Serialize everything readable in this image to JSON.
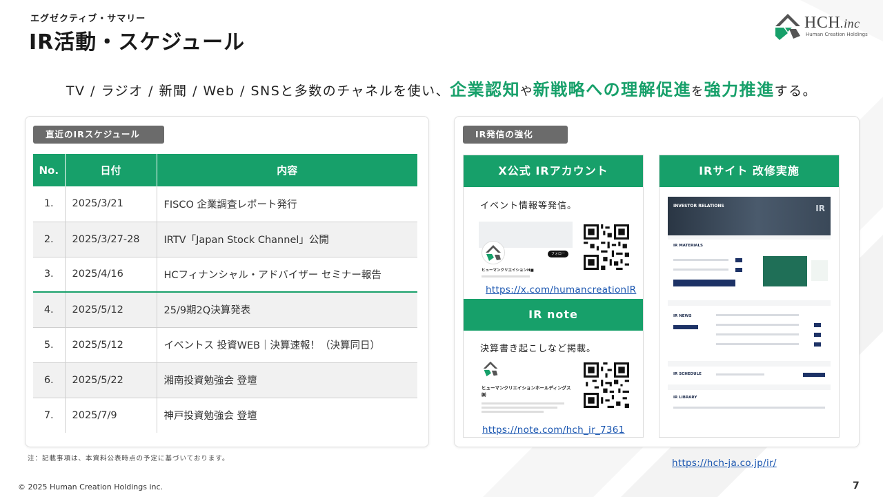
{
  "eyebrow": "エグゼクティブ・サマリー",
  "title": "IR活動・スケジュール",
  "logo": {
    "main": "HCH",
    "suffix": ".inc",
    "sub": "Human Creation Holdings"
  },
  "headline": {
    "p1": "TV / ラジオ / 新聞 / Web / SNSと多数のチャネルを使い、",
    "e1": "企業認知",
    "p2": "や",
    "e2": "新戦略への理解促進",
    "p3": "を",
    "e3": "強力推進",
    "p4": "する。"
  },
  "schedule": {
    "label": "直近のIRスケジュール",
    "headers": [
      "No.",
      "日付",
      "内容"
    ],
    "rows": [
      {
        "no": "1.",
        "date": "2025/3/21",
        "content": "FISCO 企業調査レポート発行"
      },
      {
        "no": "2.",
        "date": "2025/3/27-28",
        "content": "IRTV「Japan Stock Channel」公開"
      },
      {
        "no": "3.",
        "date": "2025/4/16",
        "content": "HCフィナンシャル・アドバイザー セミナー報告"
      },
      {
        "no": "4.",
        "date": "2025/5/12",
        "content": "25/9期2Q決算発表"
      },
      {
        "no": "5.",
        "date": "2025/5/12",
        "content": "イベントス 投資WEB｜決算速報！（決算同日）"
      },
      {
        "no": "6.",
        "date": "2025/5/22",
        "content": "湘南投資勉強会 登壇"
      },
      {
        "no": "7.",
        "date": "2025/7/9",
        "content": "神戸投資勉強会 登壇"
      }
    ]
  },
  "ir_outreach": {
    "label": "IR発信の強化",
    "x": {
      "title": "X公式 IRアカウント",
      "desc": "イベント情報等発信。",
      "profile_name": "ヒューマンクリエイションH■",
      "follow": "フォロー",
      "url": "https://x.com/humancreationIR"
    },
    "note": {
      "title": "IR note",
      "desc": "決算書き起こしなど掲載。",
      "profile_name": "ヒューマンクリエイションホールディングス㈱",
      "url": "https://note.com/hch_ir_7361"
    },
    "site": {
      "title": "IRサイト 改修実施",
      "hero_label": "INVESTOR RELATIONS",
      "hero_mark": "IR",
      "sections": [
        "IR MATERIALS",
        "IR NEWS",
        "IR SCHEDULE",
        "IR LIBRARY"
      ],
      "url": "https://hch-ja.co.jp/ir/"
    }
  },
  "footnote": "注：記載事項は、本資料公表時点の予定に基づいております。",
  "copyright": "© 2025 Human Creation Holdings inc.",
  "page_number": "7",
  "colors": {
    "accent": "#17a06a",
    "pill": "#6b6b6b",
    "link": "#1a56b0"
  }
}
